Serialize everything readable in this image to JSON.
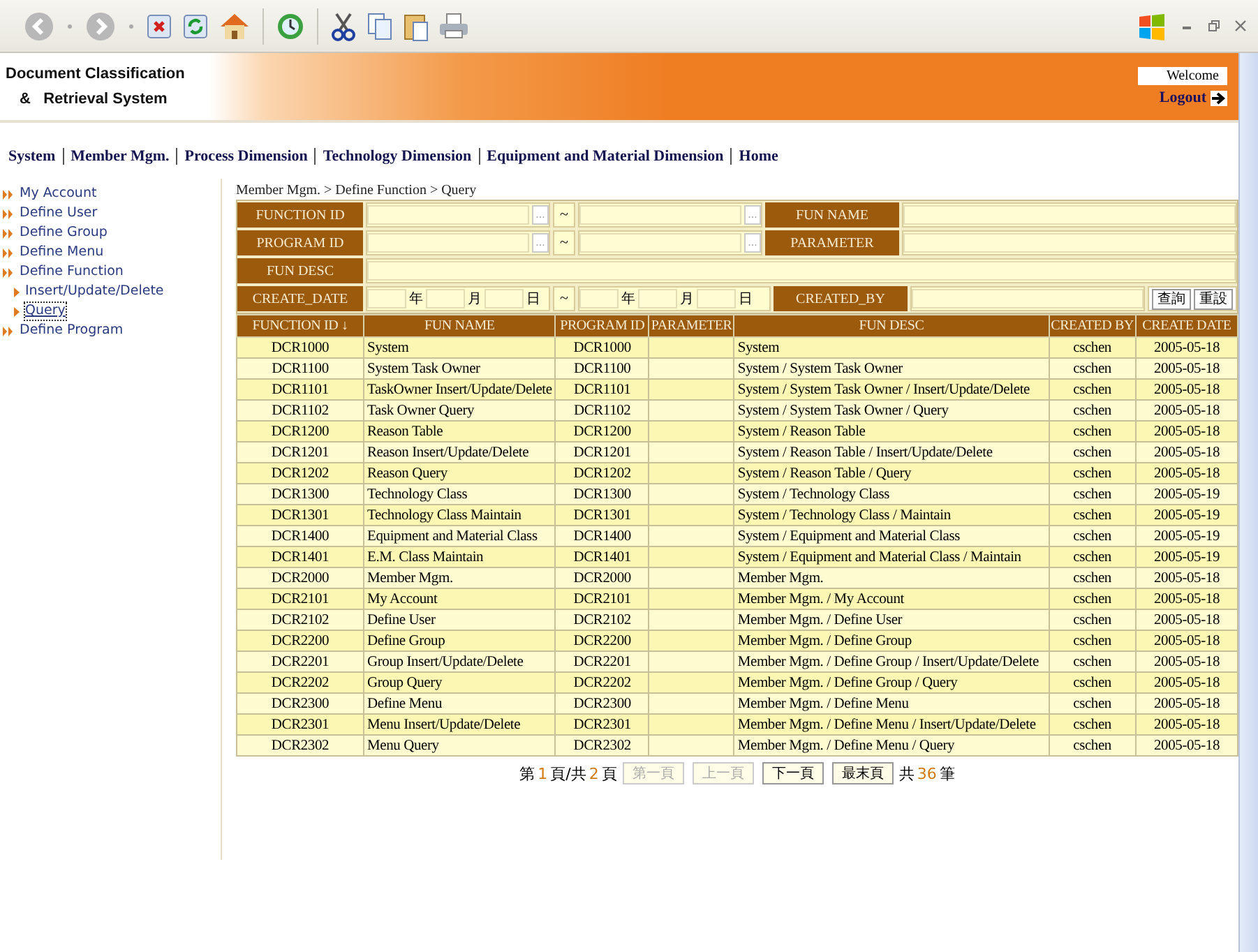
{
  "header": {
    "title_line1": "Document Classification",
    "title_line2": "&   Retrieval System",
    "welcome": "Welcome",
    "logout": "Logout"
  },
  "nav": [
    {
      "label": "System"
    },
    {
      "label": "Member Mgm."
    },
    {
      "label": "Process Dimension"
    },
    {
      "label": "Technology Dimension"
    },
    {
      "label": "Equipment and Material Dimension"
    },
    {
      "label": "Home"
    }
  ],
  "sidebar": {
    "items": [
      {
        "label": "My Account",
        "selected": false
      },
      {
        "label": "Define User",
        "selected": false
      },
      {
        "label": "Define Group",
        "selected": false
      },
      {
        "label": "Define Menu",
        "selected": false
      },
      {
        "label": "Define Function",
        "selected": false,
        "children": [
          {
            "label": "Insert/Update/Delete",
            "selected": false
          },
          {
            "label": "Query",
            "selected": true
          }
        ]
      },
      {
        "label": "Define Program",
        "selected": false
      }
    ]
  },
  "breadcrumb": "Member Mgm. > Define Function > Query",
  "form": {
    "function_id": {
      "label": "FUNCTION ID",
      "browse_from": "...",
      "tilde": "~",
      "browse_to": "..."
    },
    "program_id": {
      "label": "PROGRAM ID",
      "browse_from": "...",
      "tilde": "~",
      "browse_to": "..."
    },
    "fun_name": {
      "label": "FUN NAME"
    },
    "parameter": {
      "label": "PARAMETER"
    },
    "fun_desc": {
      "label": "FUN DESC"
    },
    "create_date": {
      "label": "CREATE_DATE",
      "from_units": [
        "年",
        "月",
        "日"
      ],
      "tilde": "~",
      "to_units": [
        "年",
        "月",
        "日"
      ]
    },
    "created_by": {
      "label": "CREATED_BY"
    },
    "buttons": [
      "查詢",
      "重設"
    ]
  },
  "table": {
    "columns": [
      "FUNCTION ID ↓",
      "FUN NAME",
      "PROGRAM ID",
      "PARAMETER",
      "FUN DESC",
      "CREATED BY",
      "CREATE DATE"
    ],
    "rows": [
      [
        "DCR1000",
        "System",
        "DCR1000",
        "",
        "System",
        "cschen",
        "2005-05-18"
      ],
      [
        "DCR1100",
        "System Task Owner",
        "DCR1100",
        "",
        "System / System Task Owner",
        "cschen",
        "2005-05-18"
      ],
      [
        "DCR1101",
        "TaskOwner Insert/Update/Delete",
        "DCR1101",
        "",
        "System / System Task Owner / Insert/Update/Delete",
        "cschen",
        "2005-05-18"
      ],
      [
        "DCR1102",
        "Task Owner Query",
        "DCR1102",
        "",
        "System / System Task Owner / Query",
        "cschen",
        "2005-05-18"
      ],
      [
        "DCR1200",
        "Reason Table",
        "DCR1200",
        "",
        "System / Reason Table",
        "cschen",
        "2005-05-18"
      ],
      [
        "DCR1201",
        "Reason Insert/Update/Delete",
        "DCR1201",
        "",
        "System / Reason Table / Insert/Update/Delete",
        "cschen",
        "2005-05-18"
      ],
      [
        "DCR1202",
        "Reason Query",
        "DCR1202",
        "",
        "System / Reason Table / Query",
        "cschen",
        "2005-05-18"
      ],
      [
        "DCR1300",
        "Technology Class",
        "DCR1300",
        "",
        "System / Technology Class",
        "cschen",
        "2005-05-19"
      ],
      [
        "DCR1301",
        "Technology Class Maintain",
        "DCR1301",
        "",
        "System / Technology Class / Maintain",
        "cschen",
        "2005-05-19"
      ],
      [
        "DCR1400",
        "Equipment and Material Class",
        "DCR1400",
        "",
        "System / Equipment and Material Class",
        "cschen",
        "2005-05-19"
      ],
      [
        "DCR1401",
        "E.M. Class Maintain",
        "DCR1401",
        "",
        "System / Equipment and Material Class / Maintain",
        "cschen",
        "2005-05-19"
      ],
      [
        "DCR2000",
        "Member Mgm.",
        "DCR2000",
        "",
        "Member Mgm.",
        "cschen",
        "2005-05-18"
      ],
      [
        "DCR2101",
        "My Account",
        "DCR2101",
        "",
        "Member Mgm. / My Account",
        "cschen",
        "2005-05-18"
      ],
      [
        "DCR2102",
        "Define User",
        "DCR2102",
        "",
        "Member Mgm. / Define User",
        "cschen",
        "2005-05-18"
      ],
      [
        "DCR2200",
        "Define Group",
        "DCR2200",
        "",
        "Member Mgm. / Define Group",
        "cschen",
        "2005-05-18"
      ],
      [
        "DCR2201",
        "Group Insert/Update/Delete",
        "DCR2201",
        "",
        "Member Mgm. / Define Group / Insert/Update/Delete",
        "cschen",
        "2005-05-18"
      ],
      [
        "DCR2202",
        "Group Query",
        "DCR2202",
        "",
        "Member Mgm. / Define Group / Query",
        "cschen",
        "2005-05-18"
      ],
      [
        "DCR2300",
        "Define Menu",
        "DCR2300",
        "",
        "Member Mgm. / Define Menu",
        "cschen",
        "2005-05-18"
      ],
      [
        "DCR2301",
        "Menu Insert/Update/Delete",
        "DCR2301",
        "",
        "Member Mgm. / Define Menu / Insert/Update/Delete",
        "cschen",
        "2005-05-18"
      ],
      [
        "DCR2302",
        "Menu Query",
        "DCR2302",
        "",
        "Member Mgm. / Define Menu / Query",
        "cschen",
        "2005-05-18"
      ]
    ]
  },
  "pager": {
    "page_prefix": "第",
    "page": "1",
    "page_mid": "頁/共",
    "pages": "2",
    "page_suffix": "頁",
    "buttons": [
      {
        "label": "第一頁",
        "disabled": true
      },
      {
        "label": "上一頁",
        "disabled": true
      },
      {
        "label": "下一頁",
        "disabled": false
      },
      {
        "label": "最末頁",
        "disabled": false
      }
    ],
    "count_prefix": "共",
    "count": "36",
    "count_suffix": "筆"
  }
}
